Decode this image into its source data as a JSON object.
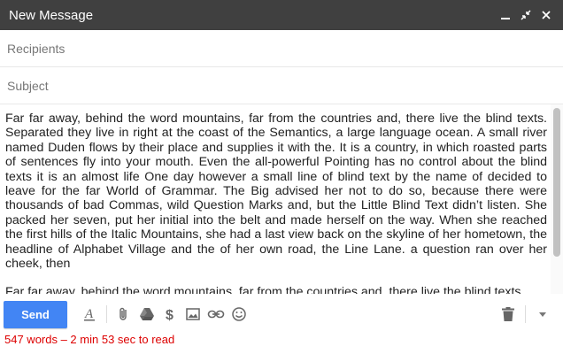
{
  "window": {
    "title": "New Message",
    "controls": [
      "minimize-icon",
      "pop-out-icon",
      "close-icon"
    ]
  },
  "compose": {
    "recipients_placeholder": "Recipients",
    "subject_placeholder": "Subject",
    "body_paragraphs": [
      "Far far away, behind the word mountains, far from the countries and, there live the blind texts. Separated they live in right at the coast of the Semantics, a large language ocean. A small river named Duden flows by their place and supplies it with the. It is a country, in which roasted parts of sentences fly into your mouth. Even the all-powerful Pointing has no control about the blind texts it is an almost life One day however a small line of blind text by the name of decided to leave for the far World of Grammar. The Big advised her not to do so, because there were thousands of bad Commas, wild Question Marks and, but the Little Blind Text didn’t listen. She packed her seven, put her initial into the belt and made herself on the way. When she reached the first hills of the Italic Mountains, she had a last view back on the skyline of her hometown, the headline of Alphabet Village and the of her own road, the Line Lane. a question ran over her cheek, then",
      "Far far away, behind the word mountains, far from the countries and, there live the blind texts."
    ]
  },
  "toolbar": {
    "send_label": "Send",
    "icons": [
      "formatting-icon",
      "attach-icon",
      "drive-icon",
      "money-icon",
      "photo-icon",
      "link-icon",
      "emoji-icon",
      "trash-icon",
      "more-options-icon"
    ]
  },
  "status": {
    "word_count_text": "547 words – 2 min 53 sec to read"
  },
  "colors": {
    "titlebar": "#404040",
    "send_button": "#4285f4",
    "status_text": "#dd0000"
  }
}
